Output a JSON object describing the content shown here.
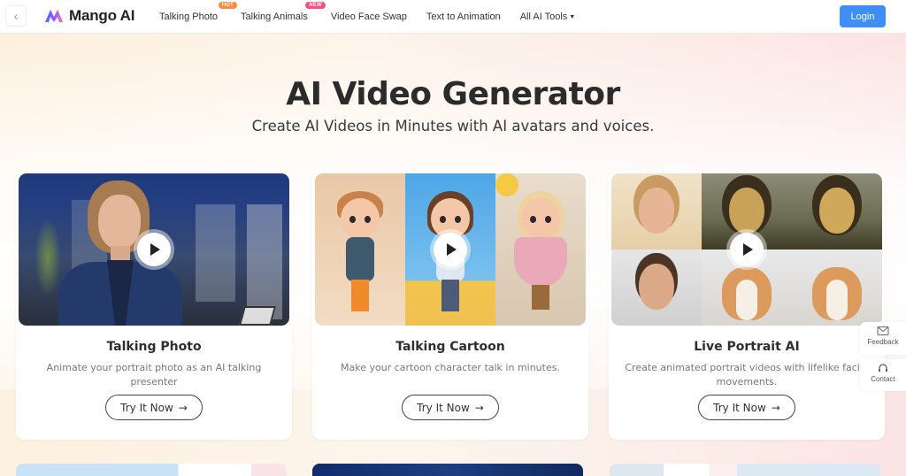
{
  "header": {
    "back_icon": "chevron-left-icon",
    "brand": "Mango AI",
    "nav": [
      {
        "label": "Talking Photo",
        "badge": "HOT"
      },
      {
        "label": "Talking Animals",
        "badge": "NEW"
      },
      {
        "label": "Video Face Swap",
        "badge": null
      },
      {
        "label": "Text to Animation",
        "badge": null
      },
      {
        "label": "All AI Tools",
        "badge": null,
        "dropdown": true
      }
    ],
    "login_label": "Login",
    "colors": {
      "login": "#3d8ef6",
      "hot": "#ff8a3d",
      "new": "#ff4f7b"
    }
  },
  "hero": {
    "title": "AI Video Generator",
    "subtitle": "Create AI Videos in Minutes with AI avatars and voices."
  },
  "cards": [
    {
      "title": "Talking Photo",
      "description": "Animate your portrait photo as an AI talking presenter",
      "cta": "Try It Now",
      "arrow": "→"
    },
    {
      "title": "Talking Cartoon",
      "description": "Make your cartoon character talk in minutes.",
      "cta": "Try It Now",
      "arrow": "→"
    },
    {
      "title": "Live Portrait AI",
      "description": "Create animated portrait videos with lifelike facial movements.",
      "cta": "Try It Now",
      "arrow": "→"
    }
  ],
  "side_actions": {
    "feedback": "Feedback",
    "contact": "Contact"
  }
}
